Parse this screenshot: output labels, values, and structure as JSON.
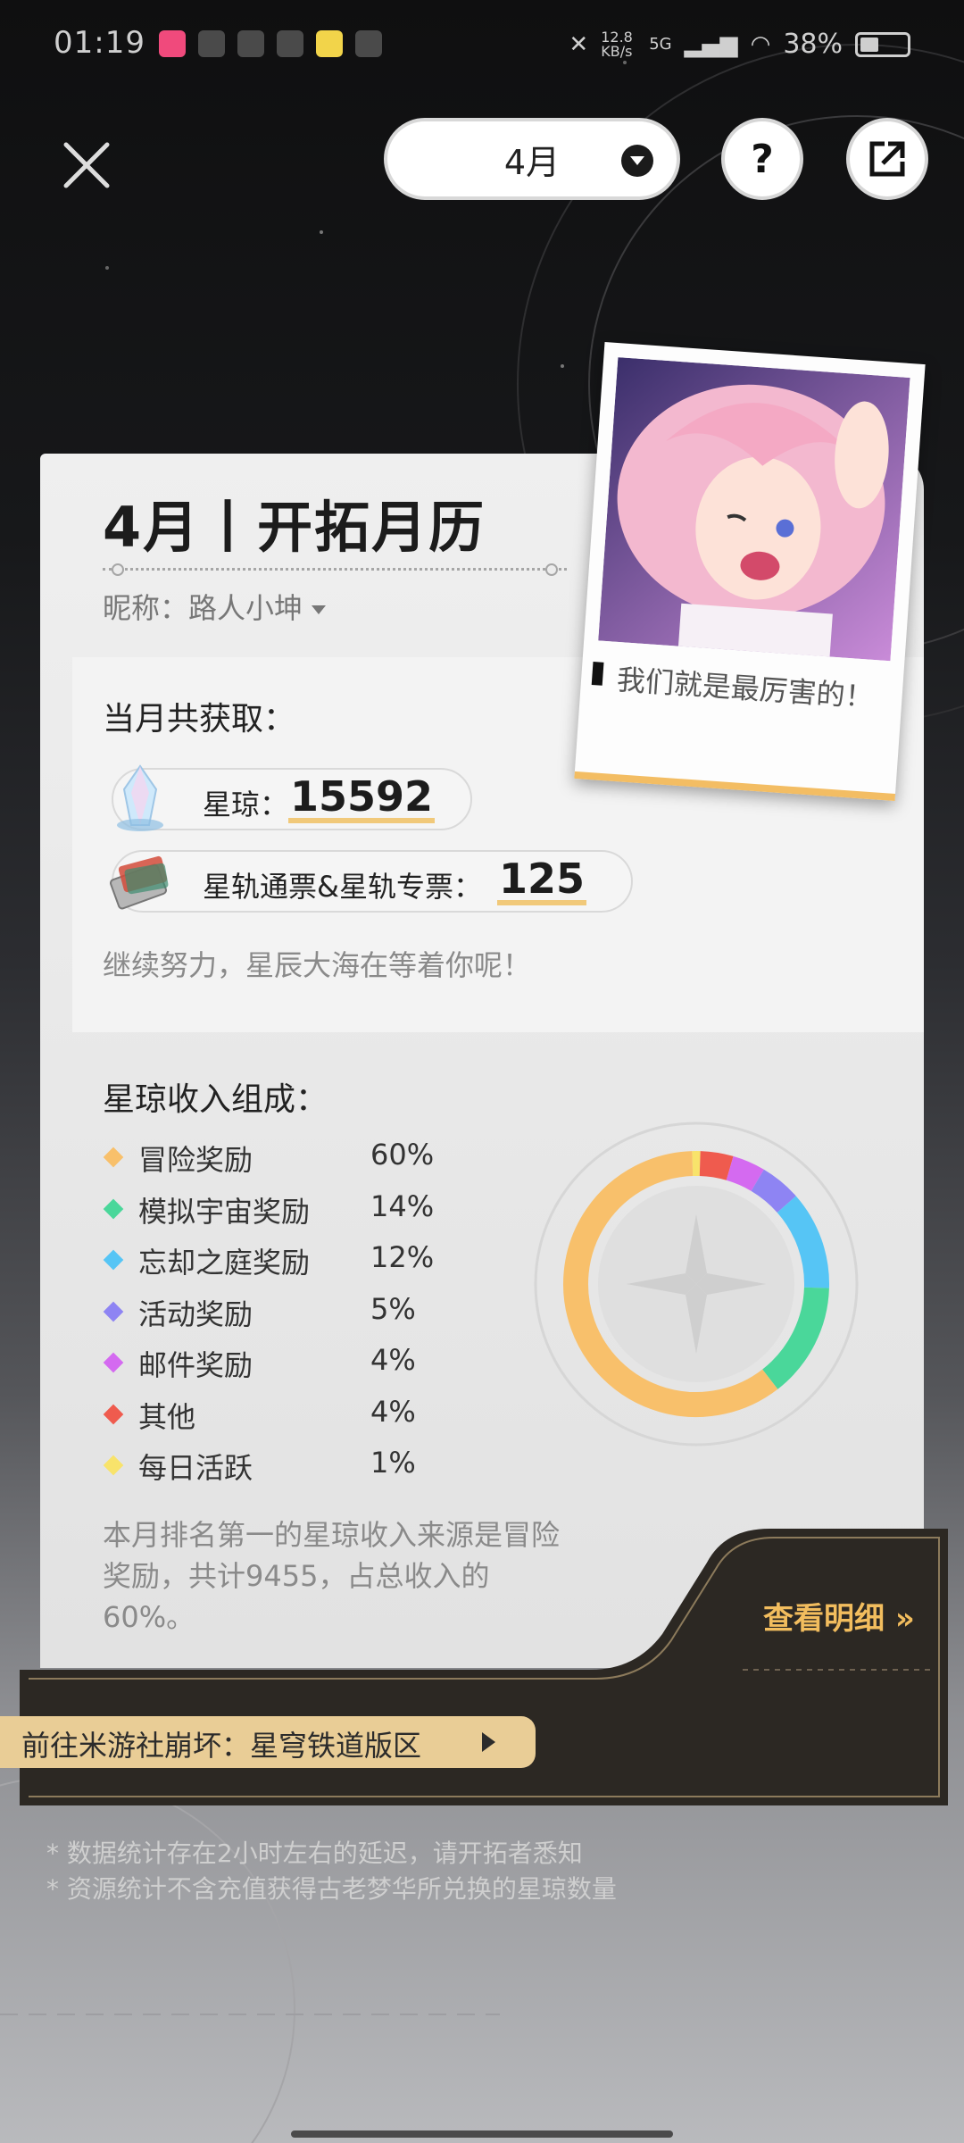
{
  "status_bar": {
    "time": "01:19",
    "net_speed": "12.8 KB/s",
    "signal": "5G",
    "battery": "38%"
  },
  "header": {
    "month_selector_value": "4月"
  },
  "card": {
    "title": "4月丨开拓月历",
    "nickname": "昵称：路人小坤",
    "earnings_heading": "当月共获取：",
    "stellar_jade_label": "星琼：",
    "stellar_jade_value": "15592",
    "pass_label": "星轨通票&星轨专票：",
    "pass_value": "125",
    "encouragement": "继续努力，星辰大海在等着你呢！",
    "income_heading": "星琼收入组成：",
    "income_breakdown": [
      {
        "name": "冒险奖励",
        "percent": "60%",
        "value": 60,
        "color": "#f8c06b"
      },
      {
        "name": "模拟宇宙奖励",
        "percent": "14%",
        "value": 14,
        "color": "#4ad79a"
      },
      {
        "name": "忘却之庭奖励",
        "percent": "12%",
        "value": 12,
        "color": "#56c5f5"
      },
      {
        "name": "活动奖励",
        "percent": "5%",
        "value": 5,
        "color": "#8e84f3"
      },
      {
        "name": "邮件奖励",
        "percent": "4%",
        "value": 4,
        "color": "#d46af0"
      },
      {
        "name": "其他",
        "percent": "4%",
        "value": 4,
        "color": "#ef5b4e"
      },
      {
        "name": "每日活跃",
        "percent": "1%",
        "value": 1,
        "color": "#f8e36b"
      }
    ],
    "summary": "本月排名第一的星琼收入来源是冒险奖励，共计9455，占总收入的60%。",
    "photo_caption": "我们就是最厉害的！"
  },
  "bottom": {
    "detail_link": "查看明细 »",
    "forum_link": "前往米游社崩坏：星穹铁道版区"
  },
  "notes": [
    "* 数据统计存在2小时左右的延迟，请开拓者悉知",
    "* 资源统计不含充值获得古老梦华所兑换的星琼数量"
  ]
}
